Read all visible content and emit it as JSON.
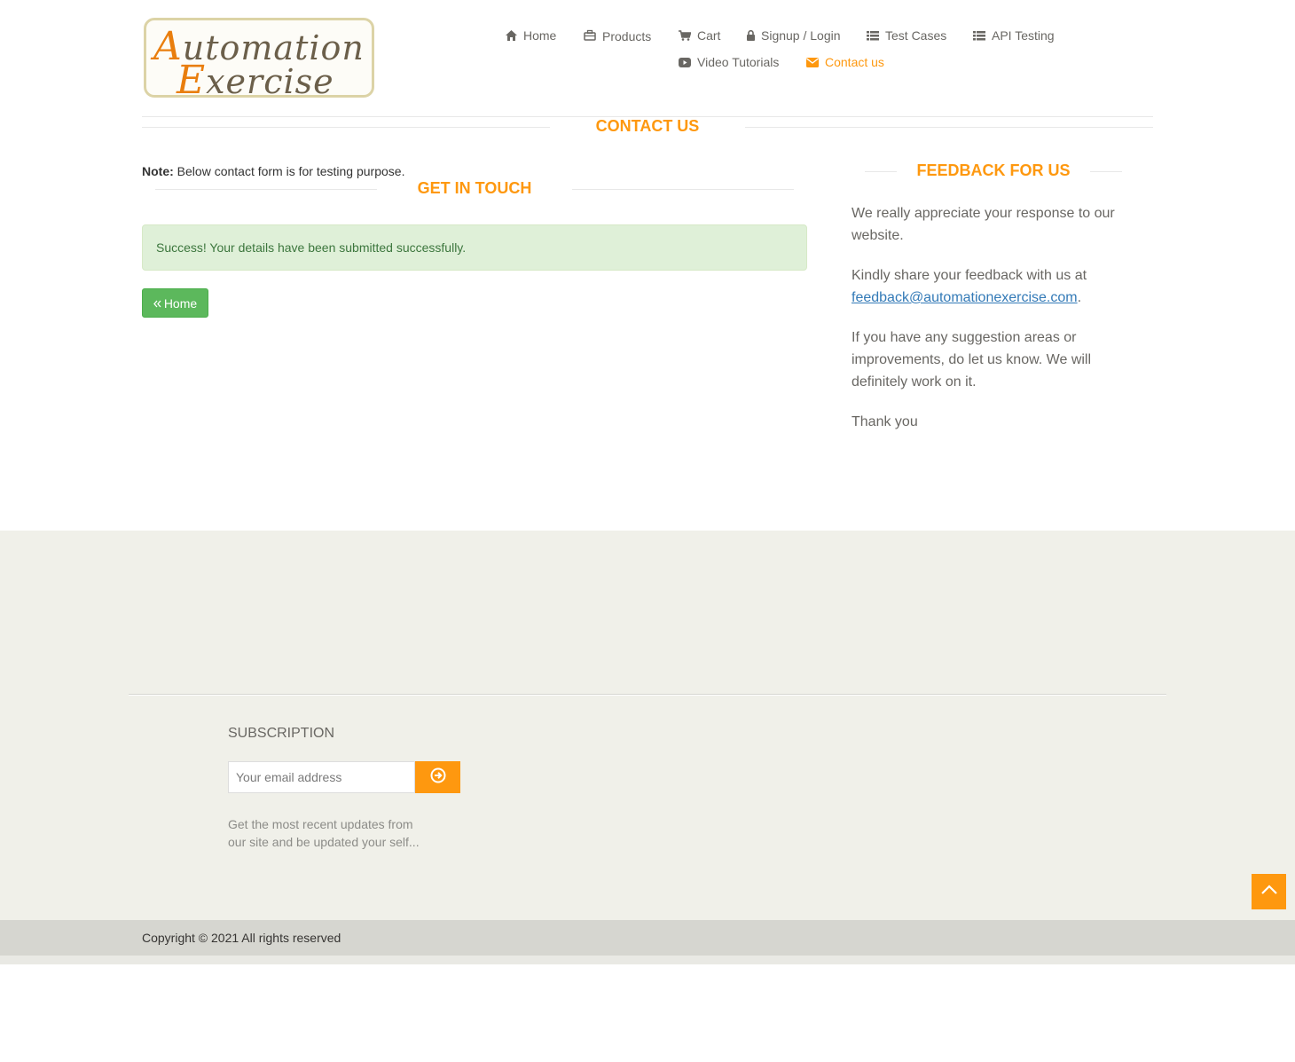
{
  "logo": {
    "line1_cap": "A",
    "line1_rest": "utomation",
    "line2_cap": "E",
    "line2_rest": "xercise"
  },
  "nav": {
    "home": "Home",
    "products": "Products",
    "cart": "Cart",
    "signup_login": "Signup / Login",
    "test_cases": "Test Cases",
    "api_testing": "API Testing",
    "video_tutorials": "Video Tutorials",
    "contact_us": "Contact us"
  },
  "page_title": "Contact Us",
  "note": {
    "label": "Note:",
    "text": " Below contact form is for testing purpose."
  },
  "get_in_touch": {
    "title": "Get In Touch",
    "success_message": "Success! Your details have been submitted successfully.",
    "home_button": "Home"
  },
  "feedback": {
    "title": "Feedback For Us",
    "p1": "We really appreciate your response to our website.",
    "p2_text": "Kindly share your feedback with us at",
    "p2_email": "feedback@automationexercise.com",
    "p2_end": ".",
    "p3": "If you have any suggestion areas or improvements, do let us know. We will definitely work on it.",
    "p4": "Thank you"
  },
  "footer": {
    "subscription_title": "Subscription",
    "email_placeholder": "Your email address",
    "subscription_text": "Get the most recent updates from our site and be updated your self...",
    "copyright": "Copyright © 2021 All rights reserved"
  },
  "colors": {
    "accent": "#fe980f",
    "success_bg": "#dff0d8",
    "success_text": "#3c763d",
    "button_green": "#5cb85c",
    "link": "#337ab7"
  }
}
